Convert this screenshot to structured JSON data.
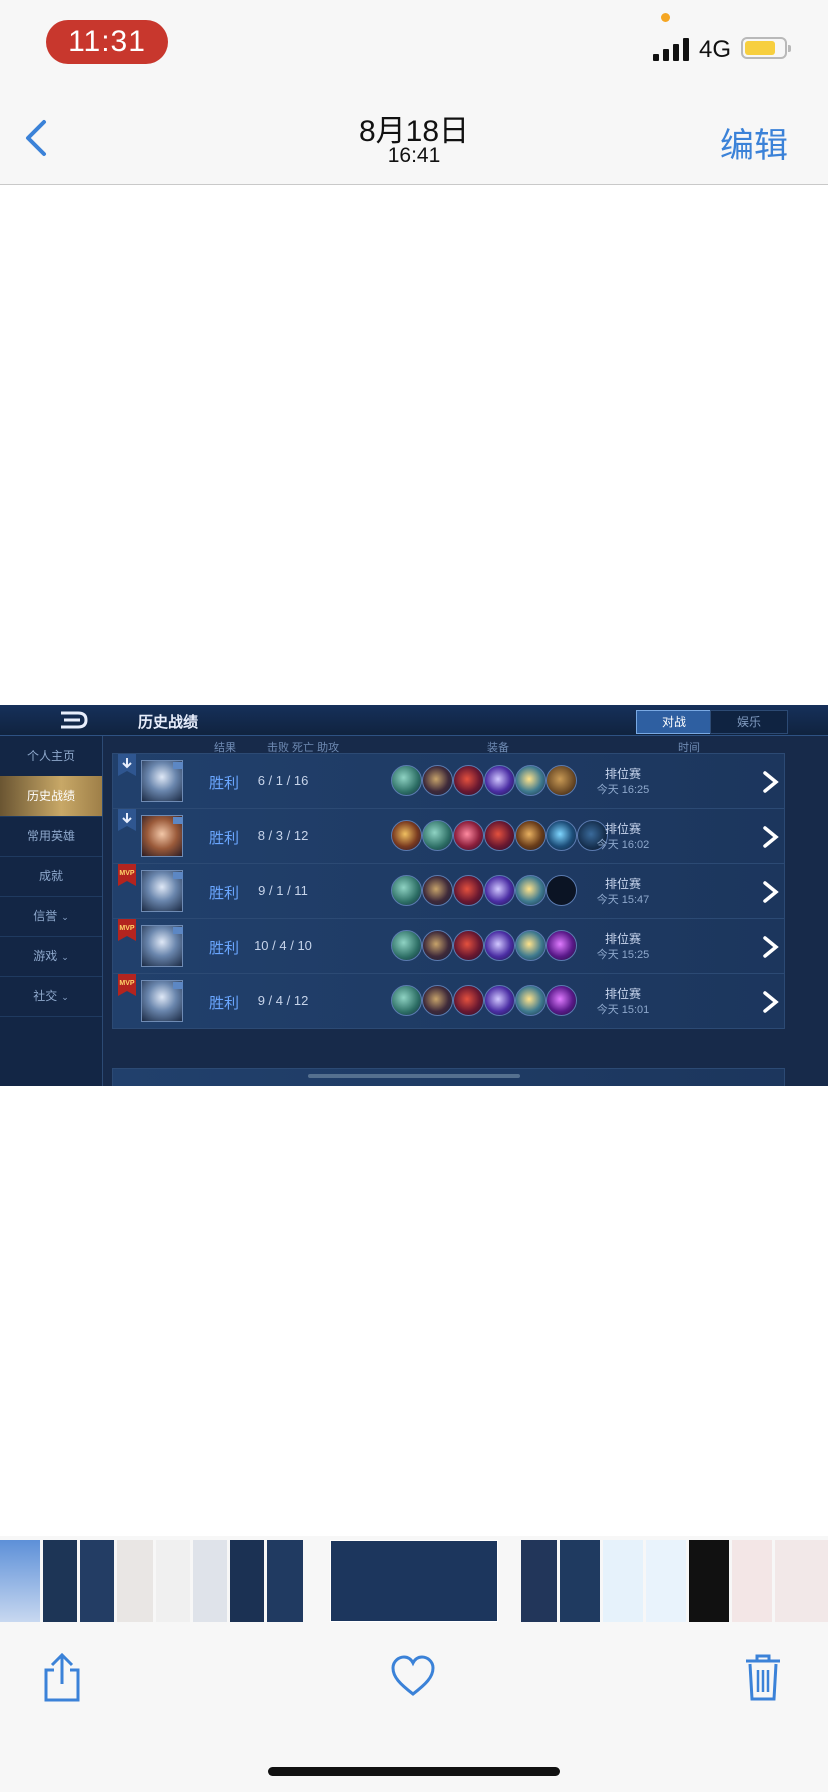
{
  "status_bar": {
    "time": "11:31",
    "network": "4G"
  },
  "nav": {
    "date": "8月18日",
    "time": "16:41",
    "edit_label": "编辑"
  },
  "game": {
    "title": "历史战绩",
    "tabs": [
      "对战",
      "娱乐"
    ],
    "sidebar": [
      "个人主页",
      "历史战绩",
      "常用英雄",
      "成就",
      "信誉",
      "游戏",
      "社交"
    ],
    "sidebar_active": 1,
    "columns": {
      "result": "结果",
      "kda": "击败 死亡 助攻",
      "equipment": "装备",
      "time": "时间"
    },
    "badge_mvp": "MVP",
    "matches": [
      {
        "result": "胜利",
        "kda": "6 / 1 / 16",
        "mode": "排位赛",
        "time": "今天 16:25",
        "badge": "down",
        "avatar": "hero-a",
        "equipment": [
          "boots-green",
          "spiked-ball",
          "red-orb",
          "purple-blade",
          "gold-gem",
          "book-brown"
        ]
      },
      {
        "result": "胜利",
        "kda": "8 / 3 / 12",
        "mode": "排位赛",
        "time": "今天 16:02",
        "badge": "down",
        "avatar": "hero-b",
        "equipment": [
          "armor-gold",
          "boots-green",
          "red-pink-blade",
          "red-orb",
          "gold-plate",
          "teal-gem",
          "dark-slot"
        ]
      },
      {
        "result": "胜利",
        "kda": "9 / 1 / 11",
        "mode": "排位赛",
        "time": "今天 15:47",
        "badge": "mvp",
        "avatar": "hero-a",
        "equipment": [
          "boots-green",
          "spiked-ball",
          "red-orb",
          "purple-blade",
          "gold-gem",
          "empty"
        ]
      },
      {
        "result": "胜利",
        "kda": "10 / 4 / 10",
        "mode": "排位赛",
        "time": "今天 15:25",
        "badge": "mvp",
        "avatar": "hero-a",
        "equipment": [
          "boots-green",
          "spiked-ball",
          "red-orb",
          "purple-blade",
          "gold-gem",
          "purple-swirl"
        ]
      },
      {
        "result": "胜利",
        "kda": "9 / 4 / 12",
        "mode": "排位赛",
        "time": "今天 15:01",
        "badge": "mvp",
        "avatar": "hero-a",
        "equipment": [
          "boots-green",
          "spiked-ball",
          "red-orb",
          "purple-blade",
          "gold-gem",
          "purple-swirl"
        ]
      }
    ]
  },
  "colors": {
    "accent_blue": "#3b82d8",
    "time_pill": "#c8372d",
    "victory_text": "#6aa6ff",
    "active_gold": "#c8a867"
  },
  "toolbar": {
    "icons": [
      "share-icon",
      "heart-icon",
      "trash-icon"
    ]
  }
}
